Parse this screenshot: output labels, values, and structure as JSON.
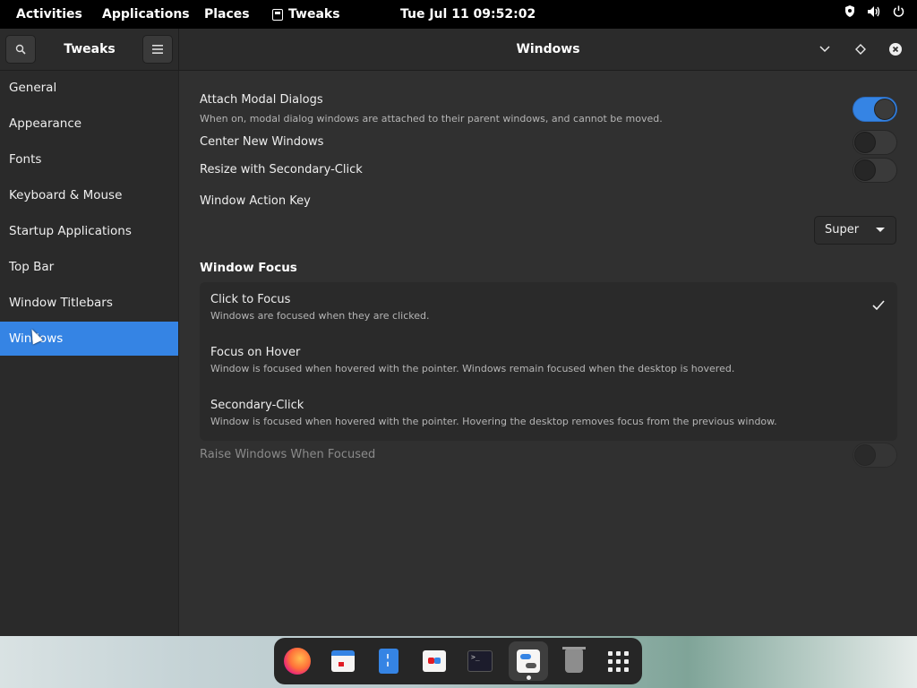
{
  "topbar": {
    "activities": "Activities",
    "applications": "Applications",
    "places": "Places",
    "app_name": "Tweaks",
    "clock": "Tue Jul 11  09:52:02",
    "status_icons": [
      "shield-icon",
      "volume-icon",
      "power-icon"
    ]
  },
  "headerbar": {
    "sidebar_title": "Tweaks",
    "title": "Windows",
    "search_icon": "⌕",
    "menu_icon": "☰"
  },
  "sidebar": {
    "items": [
      {
        "label": "General"
      },
      {
        "label": "Appearance"
      },
      {
        "label": "Fonts"
      },
      {
        "label": "Keyboard & Mouse"
      },
      {
        "label": "Startup Applications"
      },
      {
        "label": "Top Bar"
      },
      {
        "label": "Window Titlebars"
      },
      {
        "label": "Windows"
      }
    ],
    "active": "Windows"
  },
  "settings": {
    "attach_modal": {
      "title": "Attach Modal Dialogs",
      "subtitle": "When on, modal dialog windows are attached to their parent windows, and cannot be moved.",
      "enabled": true
    },
    "center_new": {
      "title": "Center New Windows",
      "enabled": false
    },
    "resize_secondary": {
      "title": "Resize with Secondary-Click",
      "enabled": false
    },
    "action_key": {
      "title": "Window Action Key",
      "value": "Super"
    }
  },
  "window_focus": {
    "section_title": "Window Focus",
    "options": [
      {
        "title": "Click to Focus",
        "subtitle": "Windows are focused when they are clicked.",
        "selected": true
      },
      {
        "title": "Focus on Hover",
        "subtitle": "Window is focused when hovered with the pointer. Windows remain focused when the desktop is hovered.",
        "selected": false
      },
      {
        "title": "Secondary-Click",
        "subtitle": "Window is focused when hovered with the pointer. Hovering the desktop removes focus from the previous window.",
        "selected": false
      }
    ],
    "raise_when_focused": {
      "title": "Raise Windows When Focused",
      "enabled": false,
      "disabled": true
    }
  },
  "dock": {
    "apps": [
      "firefox-icon",
      "calendar-icon",
      "files-icon",
      "software-icon",
      "terminal-icon",
      "tweaks-icon",
      "trash-icon",
      "show-apps-icon"
    ],
    "terminal_glyph": ">_"
  },
  "colors": {
    "accent": "#3584e4",
    "window_bg": "#303030",
    "sidebar_bg": "#2a2a2a"
  }
}
